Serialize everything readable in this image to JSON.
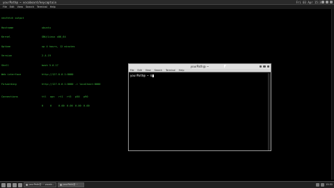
{
  "background_terminal": {
    "title": "yourPath@ ~ vocaboard/keycaptain",
    "clock": "Fri 03 Apr 15:31",
    "menu": [
      "File",
      "Edit",
      "View",
      "Search",
      "Terminal",
      "Help"
    ],
    "header": "neofetch output",
    "rows": [
      {
        "key": "Hostname",
        "value": "ubuntu"
      },
      {
        "key": "Kernel",
        "value": "GNU/Linux x86_64"
      },
      {
        "key": "Uptime",
        "value": "up 4 hours, 12 minutes"
      },
      {
        "key": "Version",
        "value": "2.4.19"
      },
      {
        "key": "Shell",
        "value": "bash 5.0.17"
      },
      {
        "key": "Web interface",
        "value": "http://127.0.0.1:8080"
      },
      {
        "key": "Forwarding",
        "value": "http://127.0.0.1:8080 -> localhost:8080"
      }
    ],
    "stats_label": "Connections",
    "stat_headers": [
      "ttl",
      "opn",
      "rt1",
      "rt5",
      "p50",
      "p90"
    ],
    "stat_values": [
      "0",
      "0",
      "0.00",
      "0.00",
      "0.00",
      "0.00"
    ]
  },
  "foreground_window": {
    "title": "yourPath@ ~",
    "menu": [
      "File",
      "Edit",
      "View",
      "Search",
      "Terminal",
      "Help"
    ],
    "prompt": "yourPath@ ~ $"
  },
  "taskbar": {
    "tasks": [
      "yourPath@ ~ vocab...",
      "yourPath@ ~"
    ],
    "clock": "15:31"
  }
}
